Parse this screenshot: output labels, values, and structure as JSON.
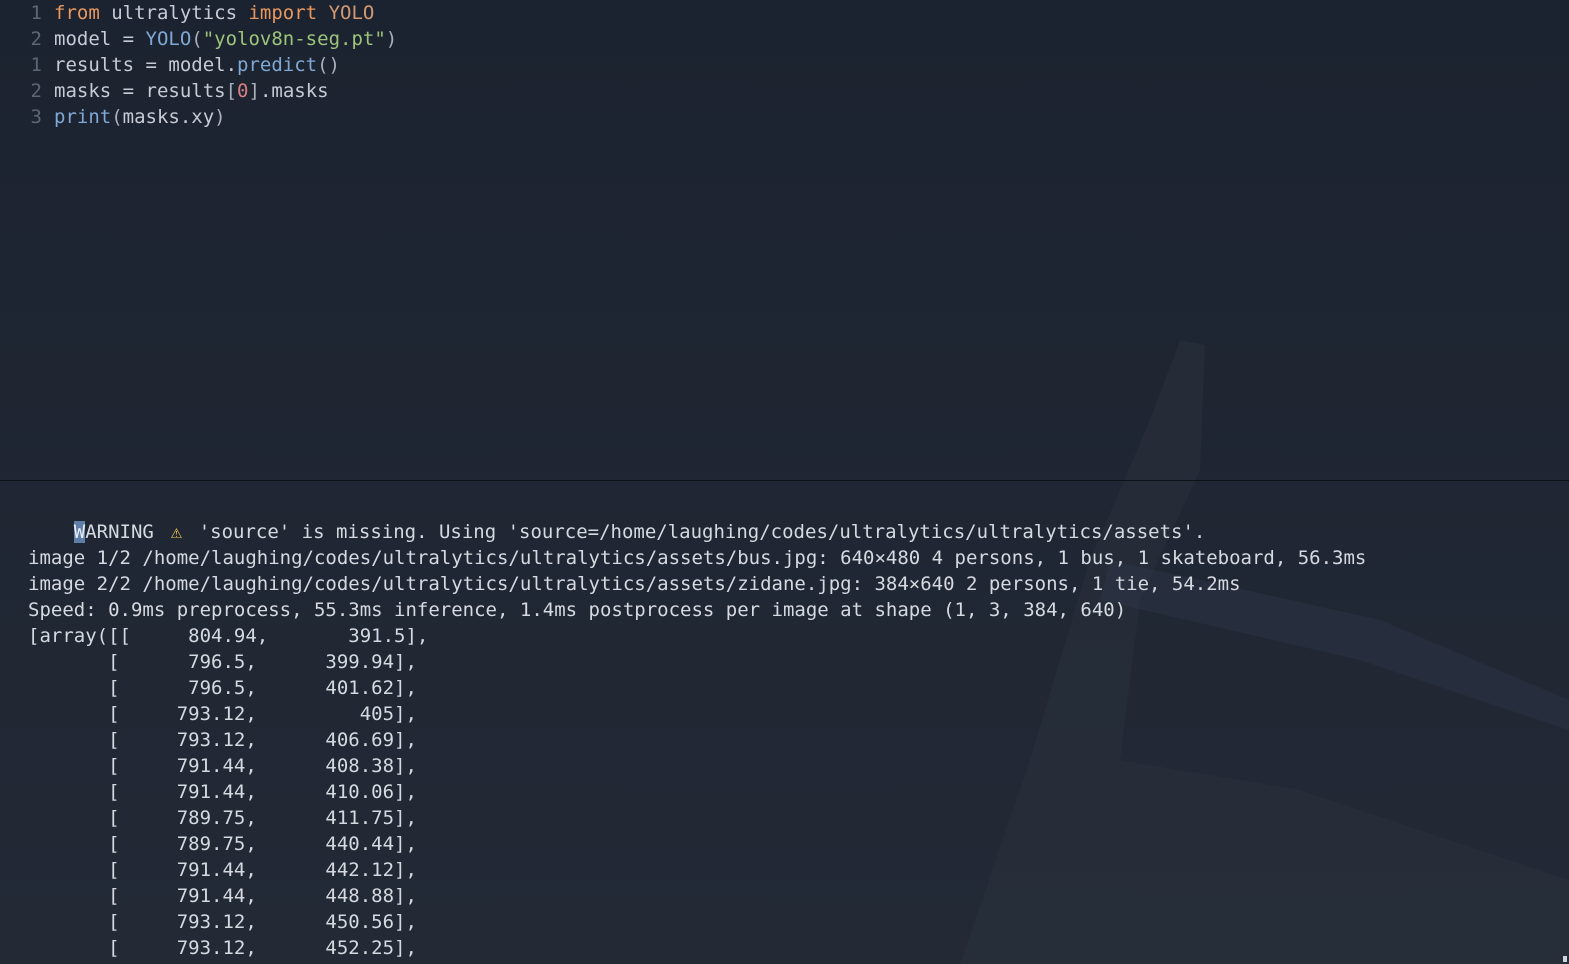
{
  "editor": {
    "lines": [
      {
        "num": "1",
        "tokens": [
          {
            "t": "from",
            "c": "kw"
          },
          {
            "t": " ultralytics ",
            "c": ""
          },
          {
            "t": "import",
            "c": "kw"
          },
          {
            "t": " ",
            "c": ""
          },
          {
            "t": "YOLO",
            "c": "cls"
          }
        ]
      },
      {
        "num": "2",
        "tokens": [
          {
            "t": "model = ",
            "c": ""
          },
          {
            "t": "YOLO",
            "c": "fn"
          },
          {
            "t": "(",
            "c": "punc"
          },
          {
            "t": "\"yolov8n-seg.pt\"",
            "c": "str"
          },
          {
            "t": ")",
            "c": "punc"
          }
        ]
      },
      {
        "num": "1",
        "tokens": [
          {
            "t": "results = model.",
            "c": ""
          },
          {
            "t": "predict",
            "c": "fn"
          },
          {
            "t": "()",
            "c": "punc"
          }
        ]
      },
      {
        "num": "2",
        "tokens": [
          {
            "t": "masks = results",
            "c": ""
          },
          {
            "t": "[",
            "c": "punc"
          },
          {
            "t": "0",
            "c": "num"
          },
          {
            "t": "]",
            "c": "punc"
          },
          {
            "t": ".masks",
            "c": ""
          }
        ]
      },
      {
        "num": "3",
        "tokens": [
          {
            "t": "print",
            "c": "fn"
          },
          {
            "t": "(",
            "c": "punc"
          },
          {
            "t": "masks.xy",
            "c": ""
          },
          {
            "t": ")",
            "c": "punc"
          }
        ]
      }
    ]
  },
  "terminal": {
    "warning": {
      "cursor_char": "W",
      "prefix_rest": "ARNING ",
      "icon": "⚠",
      "icon_name": "warning-icon",
      "icon_color": "#f2c94c",
      "message": " 'source' is missing. Using 'source=/home/laughing/codes/ultralytics/ultralytics/assets'."
    },
    "lines": [
      "",
      "image 1/2 /home/laughing/codes/ultralytics/ultralytics/assets/bus.jpg: 640×480 4 persons, 1 bus, 1 skateboard, 56.3ms",
      "image 2/2 /home/laughing/codes/ultralytics/ultralytics/assets/zidane.jpg: 384×640 2 persons, 1 tie, 54.2ms",
      "Speed: 0.9ms preprocess, 55.3ms inference, 1.4ms postprocess per image at shape (1, 3, 384, 640)",
      "[array([[     804.94,       391.5],",
      "       [      796.5,      399.94],",
      "       [      796.5,      401.62],",
      "       [     793.12,         405],",
      "       [     793.12,      406.69],",
      "       [     791.44,      408.38],",
      "       [     791.44,      410.06],",
      "       [     789.75,      411.75],",
      "       [     789.75,      440.44],",
      "       [     791.44,      442.12],",
      "       [     791.44,      448.88],",
      "       [     793.12,      450.56],",
      "       [     793.12,      452.25],"
    ]
  },
  "colors": {
    "background": "#1e2532",
    "text": "#d5d9e0",
    "keyword": "#e8975e",
    "string": "#9ec47b",
    "function": "#7fa8d4",
    "number": "#d97f82",
    "cursor": "#5e7ea8"
  }
}
